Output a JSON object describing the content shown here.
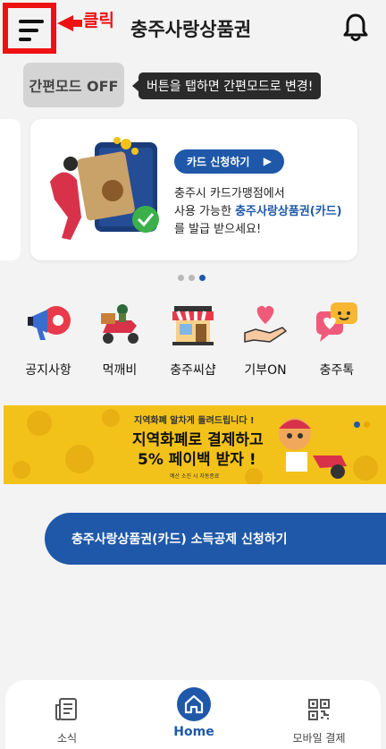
{
  "header": {
    "annotation_label": "클릭",
    "title": "충주사랑상품권",
    "menu_icon": "menu-icon",
    "bell_icon": "bell-icon"
  },
  "mode": {
    "button_label": "간편모드 OFF",
    "tooltip": "버튼을 탭하면 간편모드로 변경!"
  },
  "card": {
    "button_label": "카드 신청하기",
    "line1": "충주시 카드가맹점에서",
    "line2_prefix": "사용 가능한 ",
    "line2_highlight": "충주사랑상품권(카드)",
    "line3": "를 발급 받으세요!"
  },
  "carousel": {
    "pages": 3,
    "active": 3
  },
  "quick_menu": [
    {
      "label": "공지사항",
      "icon": "megaphone-icon"
    },
    {
      "label": "먹깨비",
      "icon": "delivery-scooter-icon"
    },
    {
      "label": "충주씨샵",
      "icon": "shop-icon"
    },
    {
      "label": "기부ON",
      "icon": "donation-heart-icon"
    },
    {
      "label": "충주톡",
      "icon": "chat-icon"
    }
  ],
  "banner": {
    "line1": "지역화폐 알차게 돌려드립니다 !",
    "line2": "지역화폐로 결제하고",
    "line3": "5% 페이백 받자 !",
    "line4": "예산 소진 시 자동종료"
  },
  "tax_button": {
    "label": "충주사랑상품권(카드) 소득공제 신청하기"
  },
  "bottom_nav": [
    {
      "label": "소식",
      "icon": "news-icon"
    },
    {
      "label": "Home",
      "icon": "home-icon"
    },
    {
      "label": "모바일 결제",
      "icon": "qr-code-icon"
    }
  ],
  "colors": {
    "accent": "#1f58a8",
    "annotation": "#ee1111",
    "banner": "#f2c21a"
  }
}
